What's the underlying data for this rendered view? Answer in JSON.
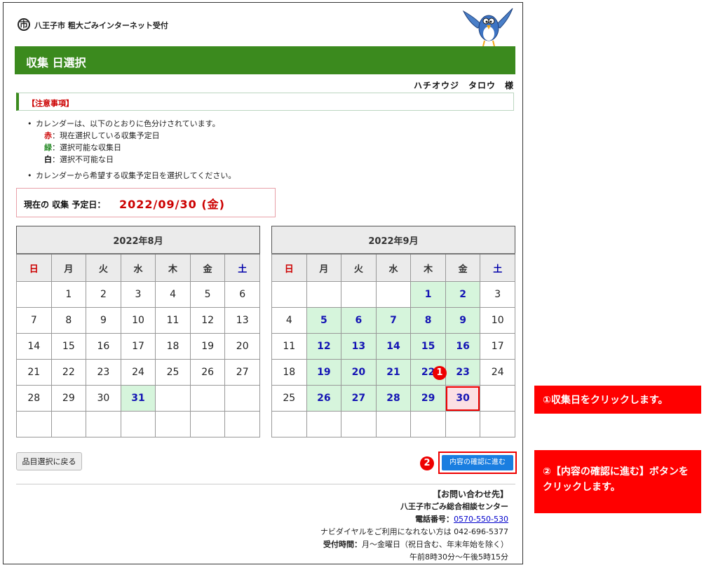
{
  "header": {
    "site_title": "八王子市 粗大ごみインターネット受付",
    "seal_glyph": "(市)",
    "mascot_icon": "bird-mascot-icon"
  },
  "page_title": "収集 日選択",
  "user_name": "ハチオウジ　タロウ　様",
  "notice": {
    "label": "【注意事項】",
    "bullet1": "カレンダーは、以下のとおりに色分けされています。",
    "legend": [
      {
        "key": "赤",
        "text": "：現在選択している収集予定日",
        "color": "#cc0000"
      },
      {
        "key": "緑",
        "text": "：選択可能な収集日",
        "color": "#2a8c2a"
      },
      {
        "key": "白",
        "text": "：選択不可能な日",
        "color": "#000000"
      }
    ],
    "bullet2": "カレンダーから希望する収集予定日を選択してください。"
  },
  "current_date": {
    "label": "現在の 収集 予定日：",
    "value": "2022/09/30 (金)"
  },
  "weekdays": [
    "日",
    "月",
    "火",
    "水",
    "木",
    "金",
    "土"
  ],
  "calendars": [
    {
      "title": "2022年8月",
      "weeks": [
        [
          "",
          "1",
          "2",
          "3",
          "4",
          "5",
          "6"
        ],
        [
          "7",
          "8",
          "9",
          "10",
          "11",
          "12",
          "13"
        ],
        [
          "14",
          "15",
          "16",
          "17",
          "18",
          "19",
          "20"
        ],
        [
          "21",
          "22",
          "23",
          "24",
          "25",
          "26",
          "27"
        ],
        [
          "28",
          "29",
          "30",
          "31",
          "",
          "",
          ""
        ],
        [
          "",
          "",
          "",
          "",
          "",
          "",
          ""
        ]
      ],
      "available": [
        "31"
      ],
      "selected": ""
    },
    {
      "title": "2022年9月",
      "weeks": [
        [
          "",
          "",
          "",
          "",
          "1",
          "2",
          "3"
        ],
        [
          "4",
          "5",
          "6",
          "7",
          "8",
          "9",
          "10"
        ],
        [
          "11",
          "12",
          "13",
          "14",
          "15",
          "16",
          "17"
        ],
        [
          "18",
          "19",
          "20",
          "21",
          "22",
          "23",
          "24"
        ],
        [
          "25",
          "26",
          "27",
          "28",
          "29",
          "30",
          ""
        ],
        [
          "",
          "",
          "",
          "",
          "",
          "",
          ""
        ]
      ],
      "available": [
        "1",
        "2",
        "5",
        "6",
        "7",
        "8",
        "9",
        "12",
        "13",
        "14",
        "15",
        "16",
        "19",
        "20",
        "21",
        "22",
        "23",
        "26",
        "27",
        "28",
        "29"
      ],
      "selected": "30"
    }
  ],
  "markers": {
    "one": "1",
    "two": "2"
  },
  "buttons": {
    "back": "品目選択に戻る",
    "confirm": "内容の確認に進む"
  },
  "contact": {
    "heading": "【お問い合わせ先】",
    "center": "八王子市ごみ総合相談センター",
    "phone_label": "電話番号：",
    "phone": "0570-550-530",
    "alt_line": "ナビダイヤルをご利用になれない方は 042-696-5377",
    "hours_label": "受付時間：",
    "hours": "月～金曜日（祝日含む、年末年始を除く）",
    "hours2": "午前8時30分～午後5時15分"
  },
  "callouts": {
    "one": "①収集日をクリックします。",
    "two": "②【内容の確認に進む】ボタンをクリックします。"
  }
}
